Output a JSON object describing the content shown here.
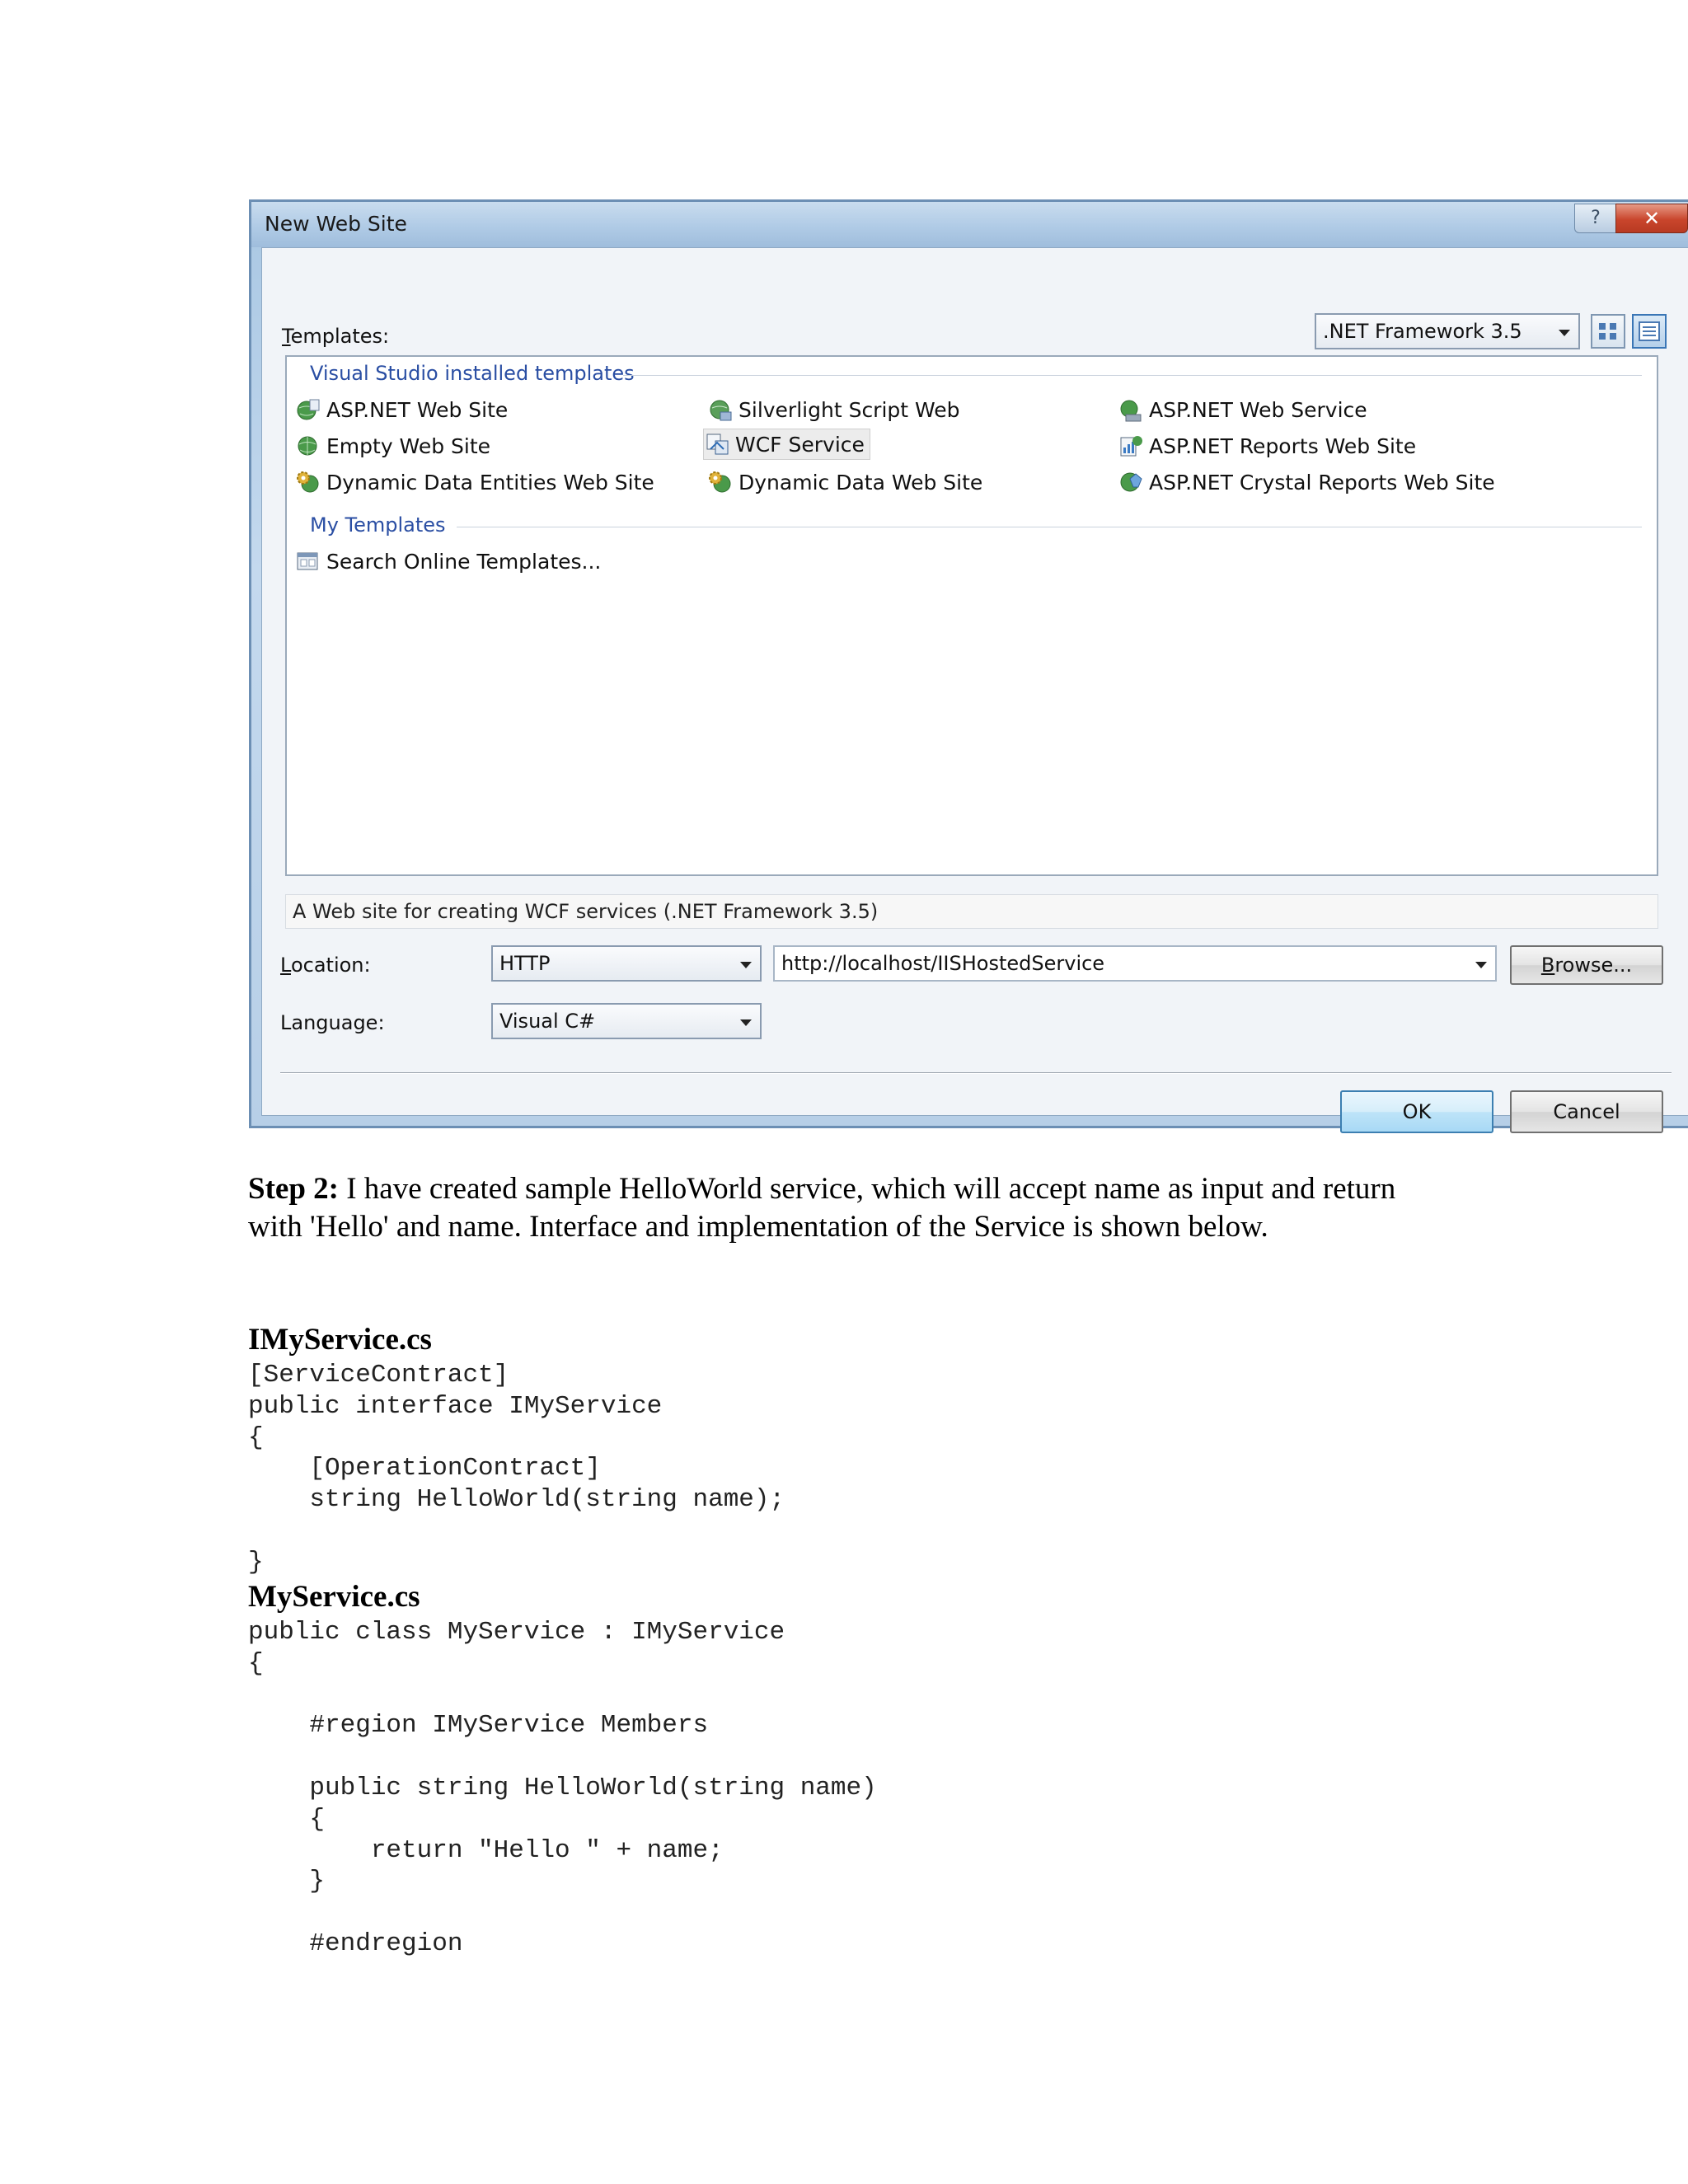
{
  "dialog": {
    "title": "New Web Site",
    "help_glyph": "?",
    "close_glyph": "✕",
    "templates_label_u": "T",
    "templates_label_rest": "emplates:",
    "framework": ".NET Framework 3.5",
    "groups": {
      "installed": "Visual Studio installed templates",
      "mine": "My Templates"
    },
    "templates": [
      "ASP.NET Web Site",
      "Silverlight Script Web",
      "ASP.NET Web Service",
      "Empty Web Site",
      "WCF Service",
      "ASP.NET Reports Web Site",
      "Dynamic Data Entities Web Site",
      "Dynamic Data Web Site",
      "ASP.NET Crystal Reports Web Site"
    ],
    "my_templates": [
      "Search Online Templates..."
    ],
    "description": "A Web site for creating WCF services (.NET Framework 3.5)",
    "location_label_u": "L",
    "location_label_rest": "ocation:",
    "location_type": "HTTP",
    "location_url": "http://localhost/IISHostedService",
    "browse_u": "B",
    "browse_rest": "rowse...",
    "language_label": "Language:",
    "language": "Visual C#",
    "ok": "OK",
    "cancel": "Cancel",
    "icon_colors": {
      "globe": "#3f8f3f",
      "gear": "#d7a51c",
      "accent": "#2f6db5"
    }
  },
  "doc": {
    "step_label": "Step 2:",
    "step_text": " I have created sample HelloWorld service, which will accept name as input and return with 'Hello' and name. Interface and implementation of the Service is shown below.",
    "file1": "IMyService.cs",
    "code1": "[ServiceContract]\npublic interface IMyService\n{\n    [OperationContract]\n    string HelloWorld(string name);\n\n}",
    "file2": "MyService.cs",
    "code2": "public class MyService : IMyService\n{\n\n    #region IMyService Members\n\n    public string HelloWorld(string name)\n    {\n        return \"Hello \" + name;\n    }\n\n    #endregion"
  }
}
